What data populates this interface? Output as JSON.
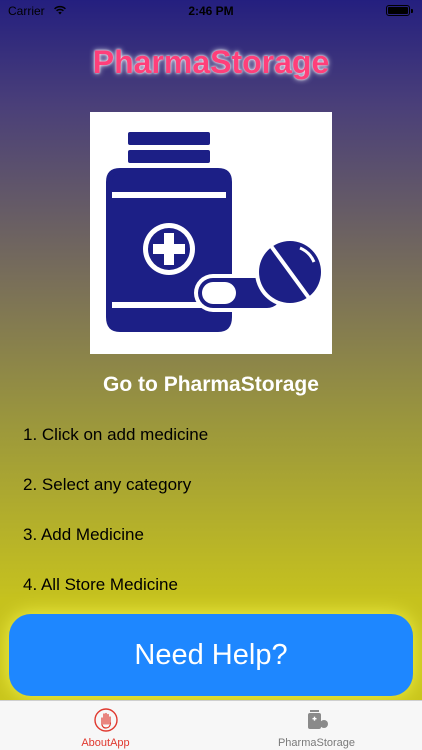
{
  "status_bar": {
    "carrier": "Carrier",
    "time": "2:46 PM"
  },
  "header": {
    "title": "PharmaStorage"
  },
  "logo": {
    "icon": "medicine-bottle-and-pills",
    "color": "#1c1f86"
  },
  "main": {
    "heading": "Go to PharmaStorage",
    "steps": [
      "1. Click on add medicine",
      "2. Select any category",
      "3. Add Medicine",
      "4. All Store Medicine"
    ],
    "help_button": "Need Help?"
  },
  "tabs": [
    {
      "label": "AboutApp",
      "icon": "hand-icon",
      "active": true
    },
    {
      "label": "PharmaStorage",
      "icon": "pills-icon",
      "active": false
    }
  ],
  "colors": {
    "title": "#ff3f7a",
    "button": "#1e87ff",
    "tab_active": "#e0392f",
    "tab_inactive": "#7a7a7a"
  }
}
